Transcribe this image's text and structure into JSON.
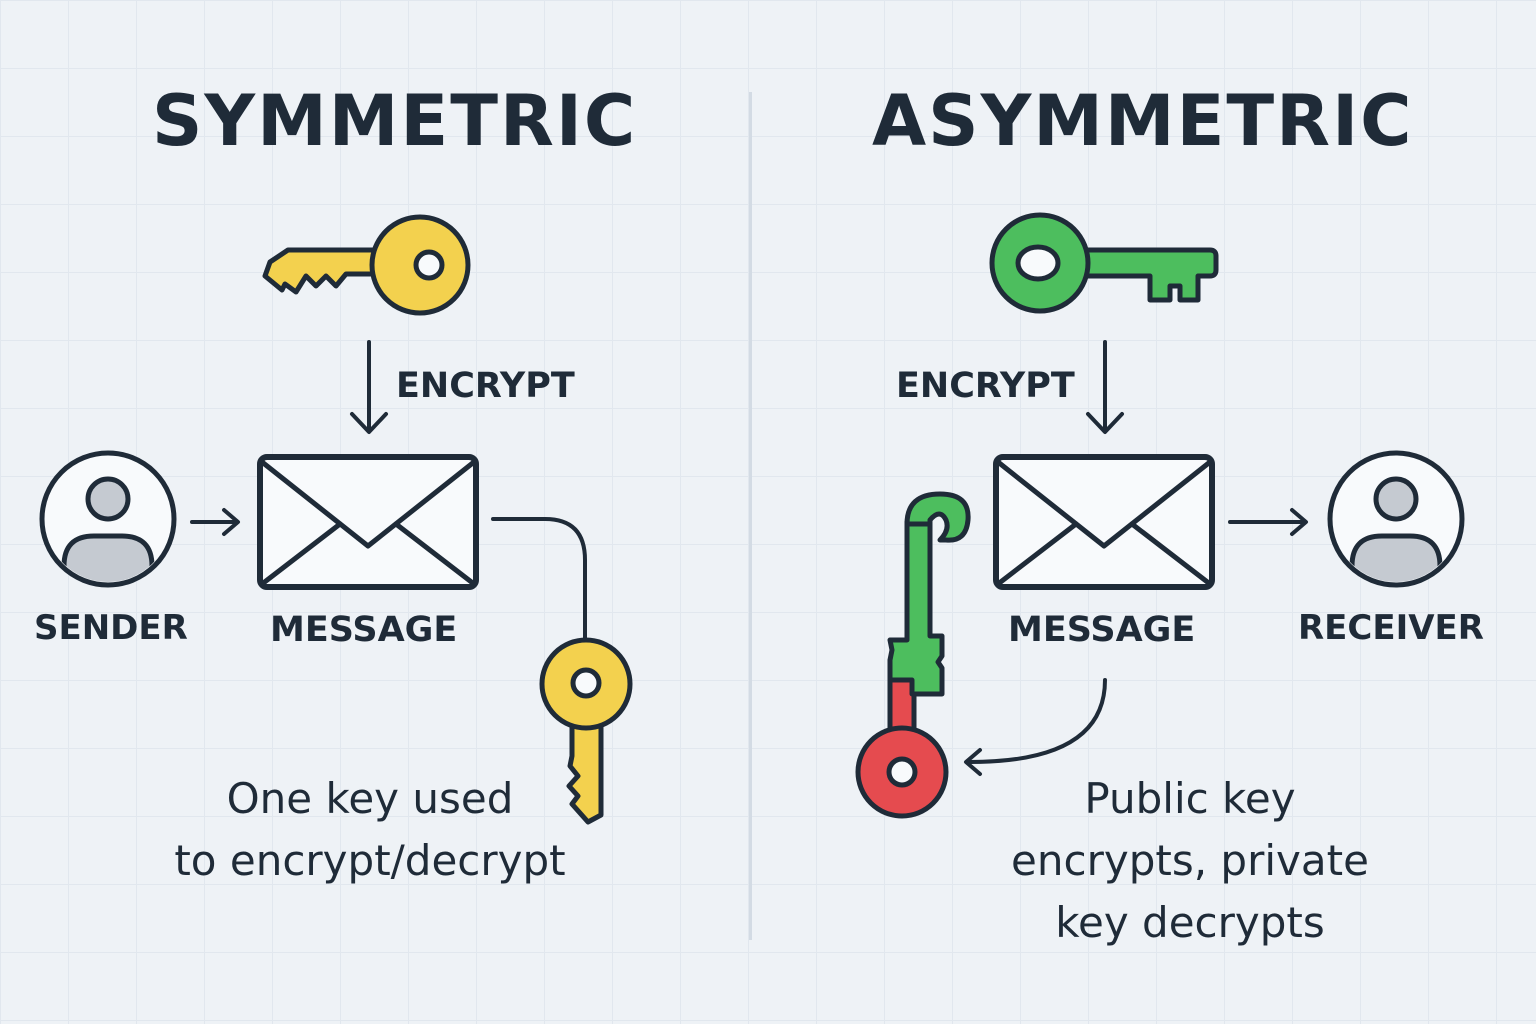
{
  "symmetric": {
    "title": "SYMMETRIC",
    "encrypt_label": "ENCRYPT",
    "sender_label": "SENDER",
    "message_label": "MESSAGE",
    "caption_line1": "One key used",
    "caption_line2": "to encrypt/decrypt",
    "key_color": "#f3d14e"
  },
  "asymmetric": {
    "title": "ASYMMETRIC",
    "encrypt_label": "ENCRYPT",
    "message_label": "MESSAGE",
    "receiver_label": "RECEIVER",
    "caption_line1": "Public key",
    "caption_line2": "encrypts, private",
    "caption_line3": "key decrypts",
    "public_key_color": "#4dbe5e",
    "private_key_color": "#e54b4f"
  },
  "icons": {
    "sender": "user-icon",
    "receiver": "user-icon",
    "message": "envelope-icon",
    "symmetric_key": "key-icon",
    "public_key": "key-icon",
    "private_key": "key-icon"
  }
}
